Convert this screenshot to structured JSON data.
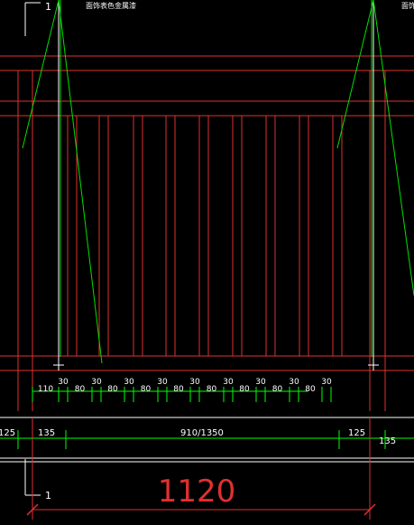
{
  "drawing": {
    "note_text": "面饰表色金属漆",
    "section_marks": {
      "top": "1",
      "bottom": "1"
    },
    "total_width": "1120",
    "slat_dims": [
      "110",
      "30",
      "80",
      "30",
      "80",
      "30",
      "80",
      "30",
      "80",
      "30",
      "80",
      "30",
      "80",
      "30",
      "80",
      "30",
      "80",
      "30"
    ],
    "overall_dims": [
      "125",
      "135",
      "910/1350",
      "125",
      "135"
    ]
  },
  "colors": {
    "background": "#000000",
    "frame": "#e03030",
    "dimension": "#00ff00",
    "leader": "#00e000",
    "text": "#ffffff",
    "total_dim_text": "#e03030",
    "axis": "#ffffff"
  }
}
